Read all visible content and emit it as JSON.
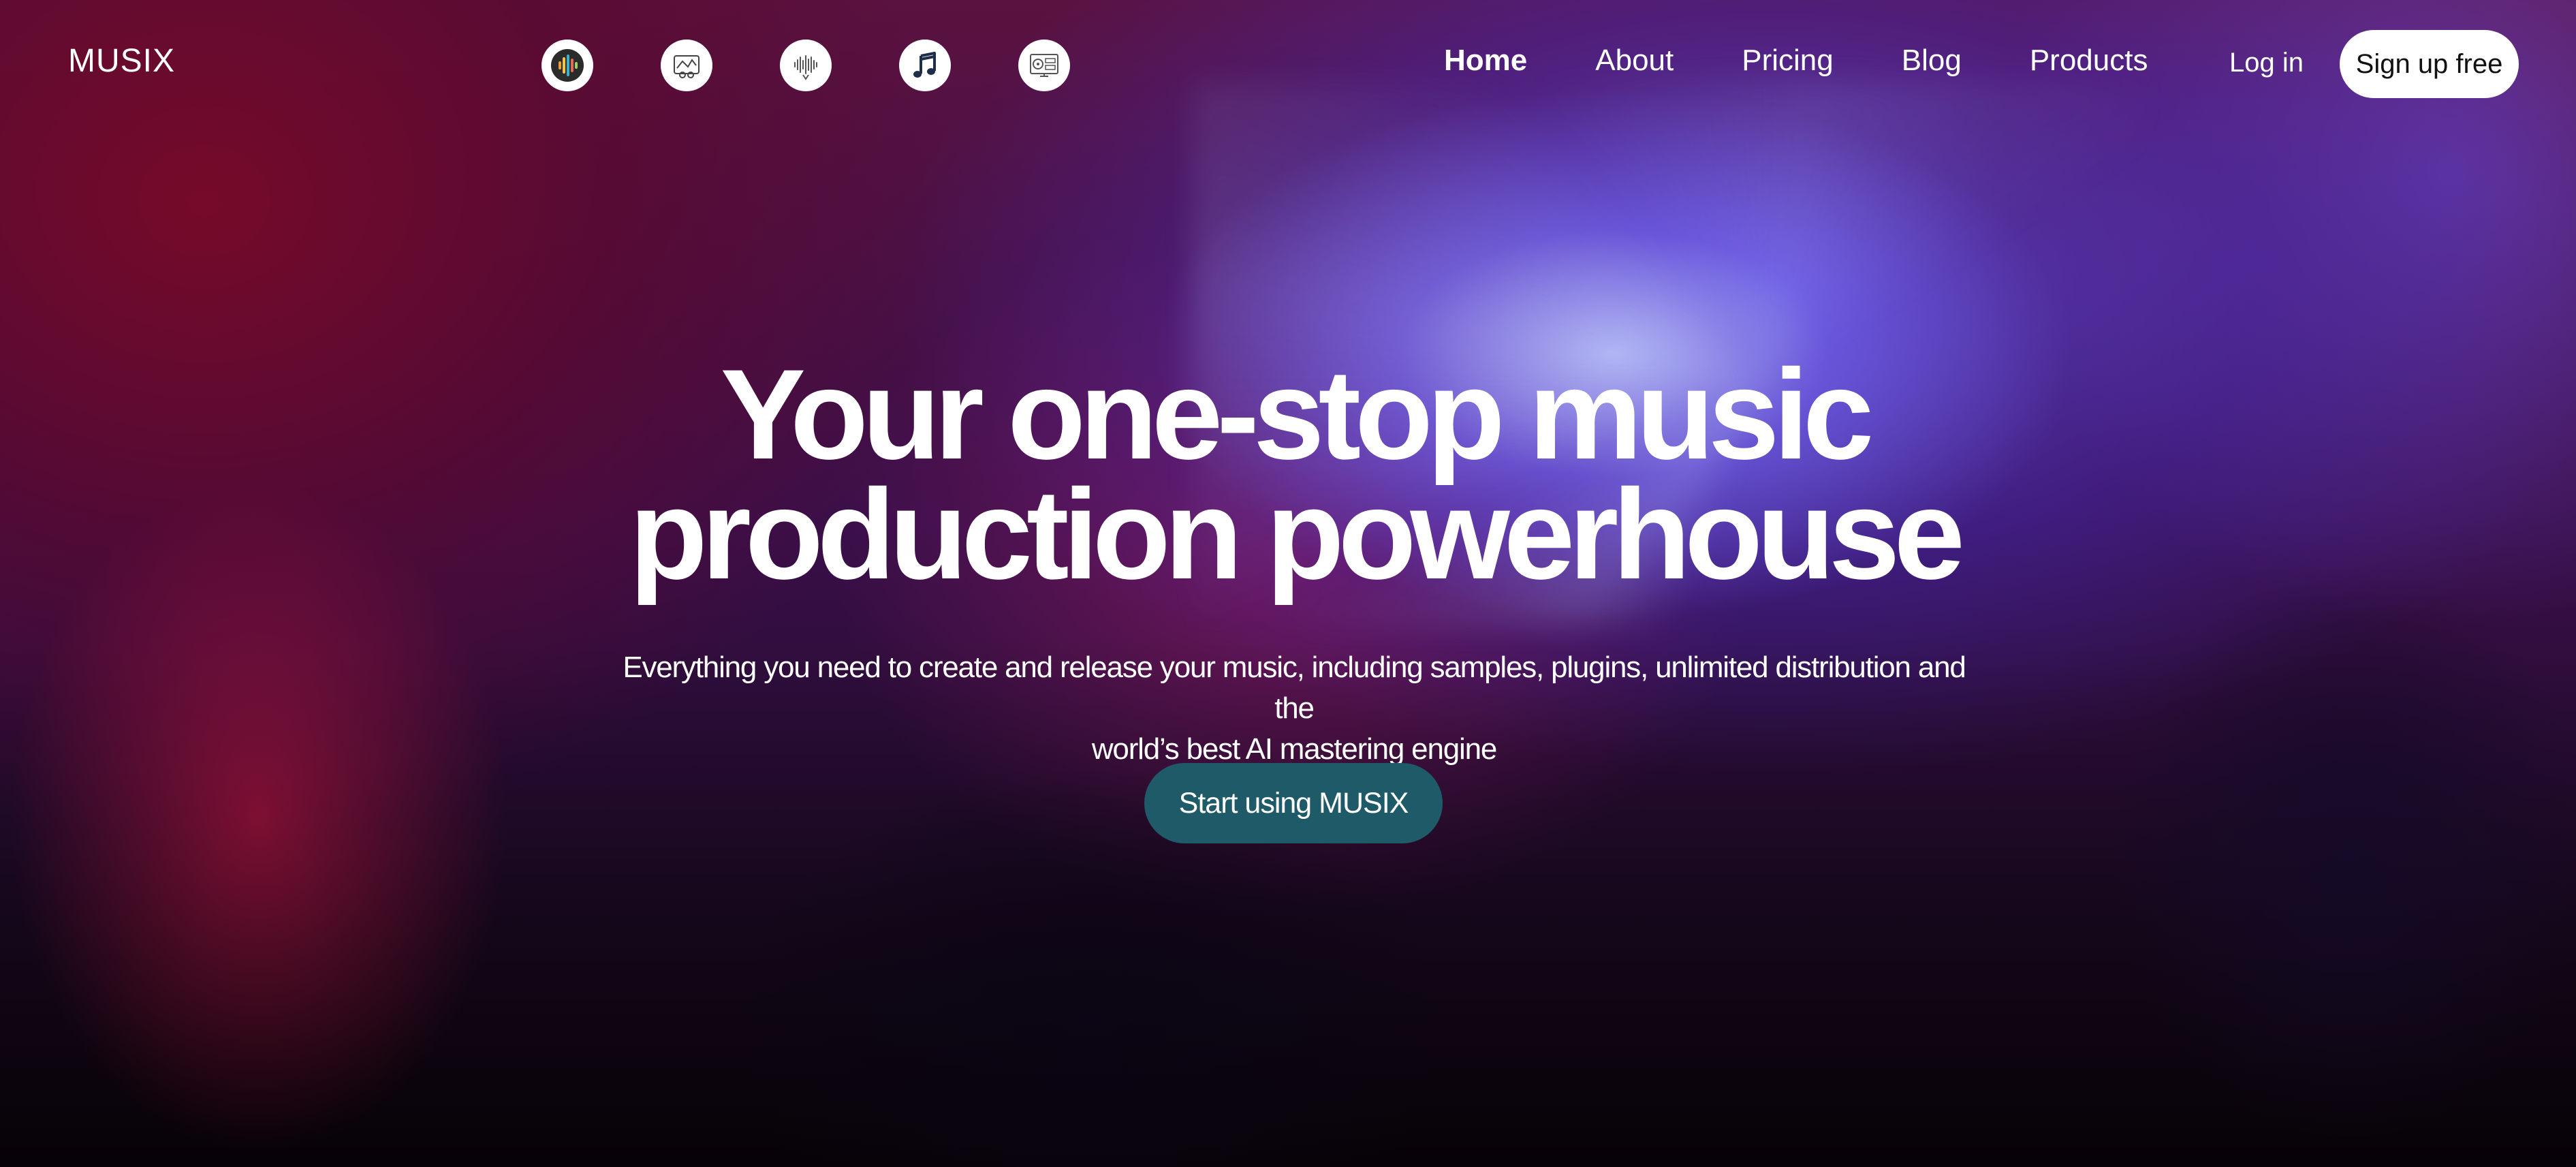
{
  "brand": {
    "logo_text": "MUSIX"
  },
  "app_icons": [
    {
      "name": "equalizer-icon"
    },
    {
      "name": "tools-icon"
    },
    {
      "name": "waveform-icon"
    },
    {
      "name": "music-note-icon"
    },
    {
      "name": "studio-icon"
    }
  ],
  "nav": {
    "items": [
      {
        "label": "Home",
        "active": true
      },
      {
        "label": "About",
        "active": false
      },
      {
        "label": "Pricing",
        "active": false
      },
      {
        "label": "Blog",
        "active": false
      },
      {
        "label": "Products",
        "active": false
      }
    ],
    "login_label": "Log in",
    "signup_label": "Sign up free"
  },
  "hero": {
    "title_line1": "Your one-stop music",
    "title_line2": "production powerhouse",
    "subtitle_line1": "Everything you need to create and release your music, including samples, plugins, unlimited distribution and the",
    "subtitle_line2": "world’s best AI mastering engine",
    "cta_label": "Start using MUSIX"
  },
  "colors": {
    "cta_background": "#1f5a69",
    "signup_background": "#ffffff",
    "text": "#ffffff"
  }
}
